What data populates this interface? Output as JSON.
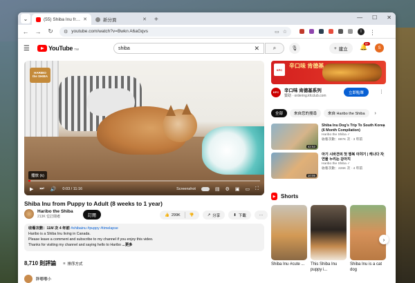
{
  "browser": {
    "tabs": [
      {
        "title": "(55) Shiba Inu from Puppy to A",
        "active": true
      },
      {
        "title": "新分頁",
        "active": false
      }
    ],
    "new_tab": "+",
    "url": "youtube.com/watch?v=Bwkn A6aGqvs",
    "profile_initial": "I"
  },
  "youtube": {
    "logo_text": "YouTube",
    "region": "TW",
    "search_query": "shiba",
    "create_label": "建立",
    "notifications": "9+",
    "avatar_initial": "S"
  },
  "player": {
    "channel_badge_line1": "HARIBO",
    "channel_badge_line2": "the SHIBA",
    "caption_chip": "播放 (k)",
    "time": "0:03 / 11:16",
    "screenshot_label": "Screenshot",
    "progress": 0.01
  },
  "video": {
    "title": "Shiba Inu from Puppy to Adult (8 weeks to 1 year)",
    "channel": "Haribo the Shiba",
    "subscribers": "213K 位訂閱者",
    "subscribe_label": "訂閱",
    "likes": "299K",
    "share_label": "分享",
    "download_label": "下載",
    "more": "···"
  },
  "description": {
    "stats": "收看次數：11M 次  4 年前",
    "tags": "#shibainu #puppy #timelapse",
    "line1": "Haribo is a Shiba Inu living in Canada.",
    "line2": "Please leave a comment and subscribe to my channel if you enjoy this video.",
    "line3": "Thanks for visiting my channel and saying hello to Haribo",
    "more": "...更多"
  },
  "comments": {
    "count": "8,710 則評論",
    "sort_label": "排序方式",
    "next_author": "胖嘟嘟小"
  },
  "ad": {
    "headline": "辛口味 肯德基",
    "brand_logo": "KFC",
    "title": "辛口味 肯德基系列",
    "sponsor": "贊助 · ordering.kfcclub.com",
    "cta": "立即點單"
  },
  "chips": [
    "全部",
    "來自您的搜尋",
    "來自 Haribo the Shiba"
  ],
  "recommendations": [
    {
      "title": "Shiba Inu Dog's Trip To South Korea (6 Month Compilation)",
      "channel": "Haribo the Shiba ✓",
      "meta": "收看次數：897K 次 · 3 年前",
      "duration": "42:53"
    },
    {
      "title": "아기 시바견의 첫 행복 이야기 | 캐나다 자연을 누리는 강아지",
      "channel": "Haribo the Shiba ✓",
      "meta": "收看次數：226K 次 · 4 年前",
      "duration": "10:05"
    }
  ],
  "shorts": {
    "label": "Shorts",
    "items": [
      {
        "title": "Shiba Inu #cute ..."
      },
      {
        "title": "This Shiba Inu puppy i..."
      },
      {
        "title": "Shiba Inu is a cat dog"
      }
    ]
  },
  "colors": {
    "youtube_red": "#ff0000",
    "link_blue": "#065fd4",
    "kfc_red": "#d41f1f"
  }
}
